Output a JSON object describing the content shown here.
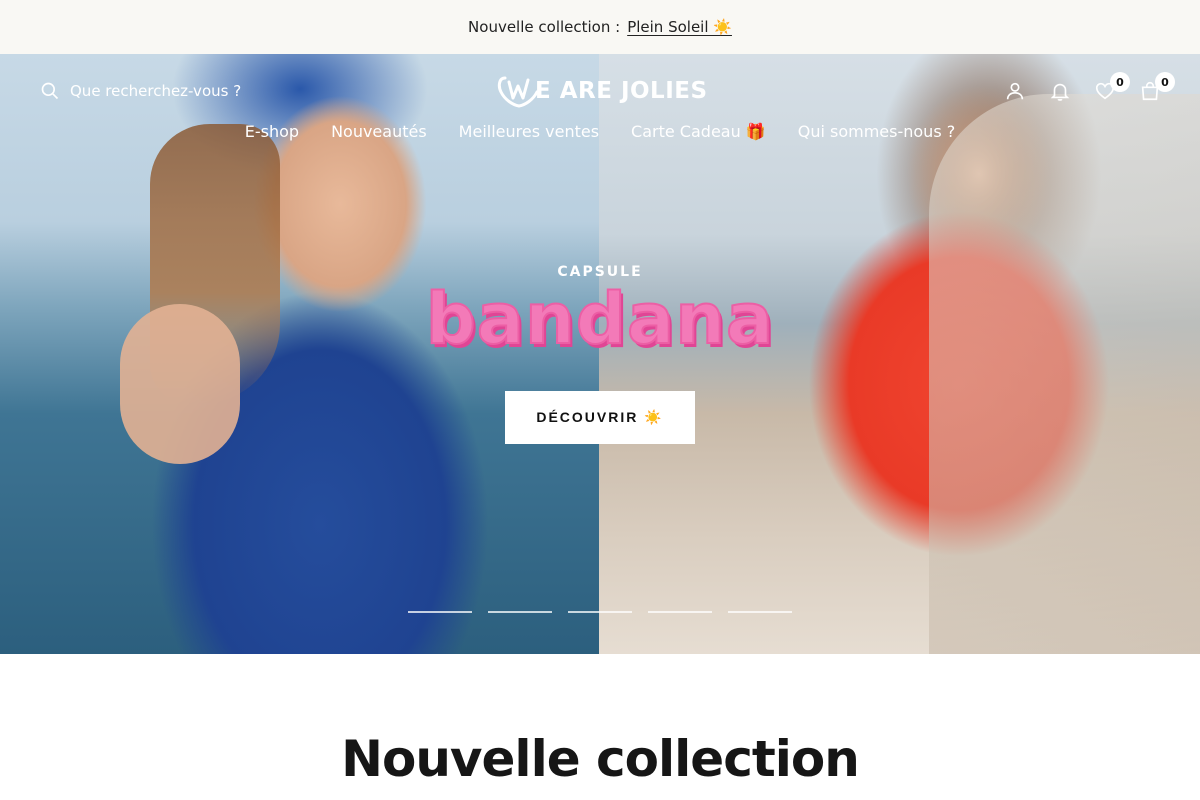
{
  "announcement": {
    "label": "Nouvelle collection :",
    "link": "Plein Soleil ☀️"
  },
  "header": {
    "search_placeholder": "Que recherchez-vous ?",
    "logo_text": "E ARE JOLIES",
    "wishlist_count": "0",
    "cart_count": "0"
  },
  "nav": {
    "items": [
      {
        "label": "E-shop"
      },
      {
        "label": "Nouveautés"
      },
      {
        "label": "Meilleures ventes"
      },
      {
        "label": "Carte Cadeau 🎁"
      },
      {
        "label": "Qui sommes-nous ?"
      }
    ]
  },
  "hero": {
    "kicker": "CAPSULE",
    "title": "bandana",
    "cta": "DÉCOUVRIR ☀️",
    "slides_count": 5
  },
  "section": {
    "title": "Nouvelle collection"
  },
  "colors": {
    "announcement_bg": "#f9f8f4",
    "hero_title": "#f37ab8",
    "left_dress": "#1f4391",
    "right_outfit": "#e93a27"
  }
}
